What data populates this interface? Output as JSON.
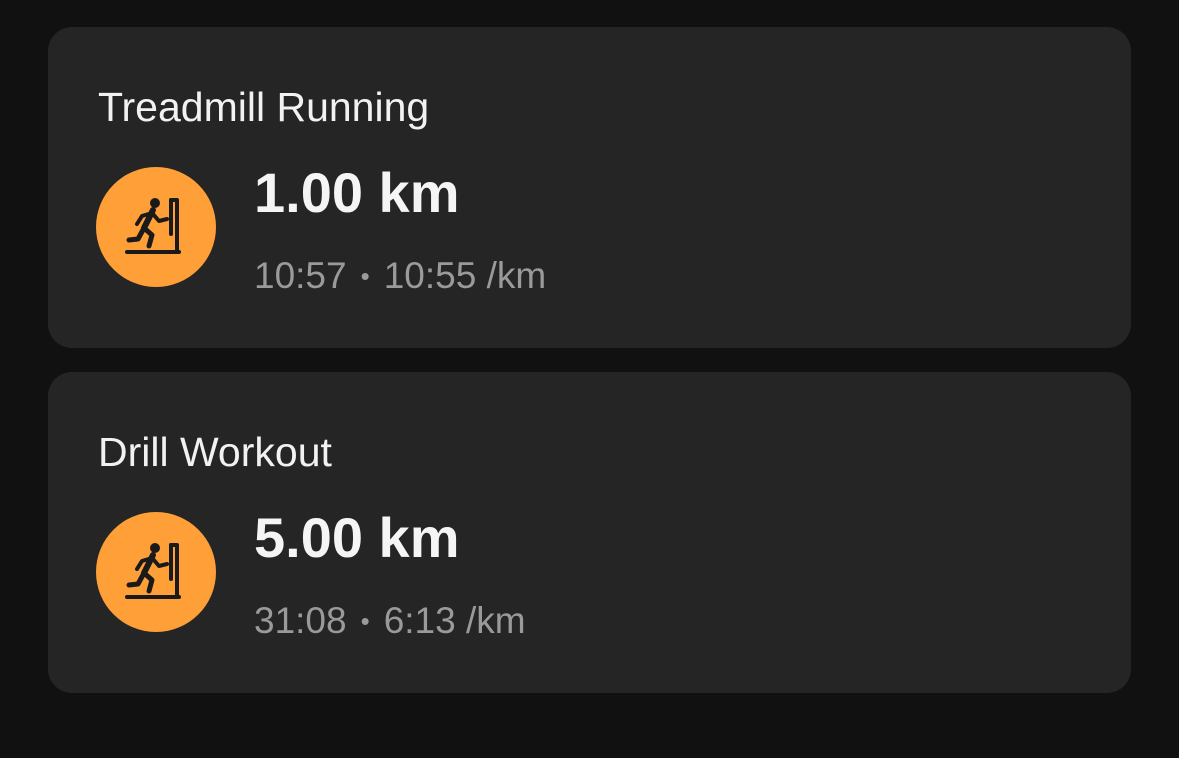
{
  "workouts": [
    {
      "title": "Treadmill Running",
      "distance": "1.00 km",
      "duration": "10:57",
      "separator": "•",
      "pace": "10:55 /km",
      "icon": "treadmill-runner-icon",
      "icon_color": "#ff9f38"
    },
    {
      "title": "Drill Workout",
      "distance": "5.00 km",
      "duration": "31:08",
      "separator": "•",
      "pace": "6:13 /km",
      "icon": "treadmill-runner-icon",
      "icon_color": "#ff9f38"
    }
  ]
}
